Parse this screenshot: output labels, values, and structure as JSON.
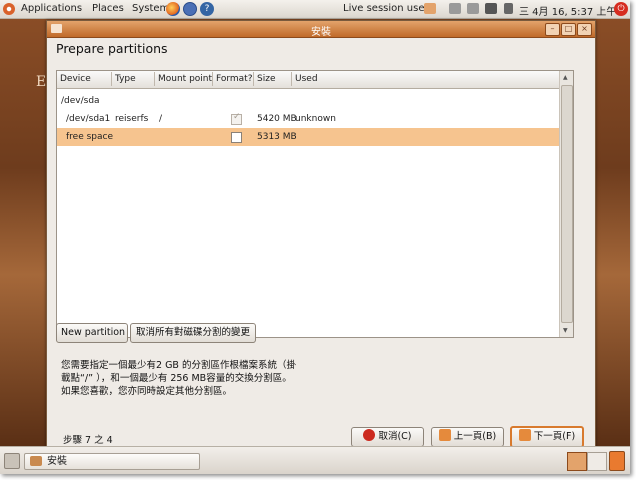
{
  "top_panel": {
    "menus": [
      "Applications",
      "Places",
      "System"
    ],
    "user": "Live session user",
    "datetime": "三 4月 16, 5:37 上午"
  },
  "dialog": {
    "title": "安裝",
    "heading": "Prepare partitions",
    "columns": [
      "Device",
      "Type",
      "Mount point",
      "Format?",
      "Size",
      "Used"
    ],
    "rows": [
      {
        "device": "/dev/sda",
        "type": "",
        "mount": "",
        "format": "",
        "size": "",
        "used": ""
      },
      {
        "device": "/dev/sda1",
        "type": "reiserfs",
        "mount": "/",
        "format": "checked",
        "size": "5420 MB",
        "used": "unknown"
      },
      {
        "device": "free space",
        "type": "",
        "mount": "",
        "format": "unchecked",
        "size": "5313 MB",
        "used": ""
      }
    ],
    "new_partition_label": "New partition",
    "undo_label": "取消所有對磁碟分割的變更",
    "info_lines": [
      "您需要指定一個最少有2 GB 的分割區作根檔案系統（掛",
      "載點“/” ），和一個最少有 256 MB容量的交換分割區。",
      "如果您喜歡，您亦同時設定其他分割區。"
    ],
    "step_label": "步驟 7 之 4",
    "cancel_label": "取消(C)",
    "back_label": "上一頁(B)",
    "forward_label": "下一頁(F)"
  },
  "desktop": {
    "glyph": "E"
  },
  "taskbar": {
    "task_label": "安裝"
  },
  "colors": {
    "accent": "#d87a2e",
    "selection": "#f6c48f",
    "titlebar": "#c06a2a"
  }
}
